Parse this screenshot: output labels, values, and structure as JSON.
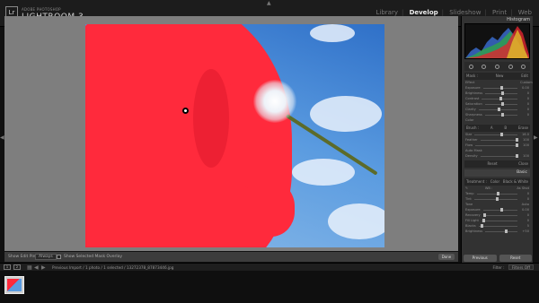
{
  "app": {
    "brand_small": "ADOBE PHOTOSHOP",
    "brand_name": "LIGHTROOM 3",
    "logo_text": "Lr"
  },
  "modules": [
    {
      "label": "Library",
      "active": false
    },
    {
      "label": "Develop",
      "active": true
    },
    {
      "label": "Slideshow",
      "active": false
    },
    {
      "label": "Print",
      "active": false
    },
    {
      "label": "Web",
      "active": false
    }
  ],
  "toolbar": {
    "overlay_label": "Show Edit Pins :",
    "overlay_value": "Always",
    "mask_label": "Show Selected Mask Overlay",
    "done_label": "Done"
  },
  "right_panel": {
    "histogram_title": "Histogram",
    "mask_header": {
      "mask": "Mask :",
      "new": "New",
      "edit": "Edit"
    },
    "adjust_rows": [
      {
        "label": "Effect",
        "value": "Custom"
      },
      {
        "label": "Exposure",
        "value": "0.00"
      },
      {
        "label": "Brightness",
        "value": "0"
      },
      {
        "label": "Contrast",
        "value": "0"
      },
      {
        "label": "Saturation",
        "value": "0"
      },
      {
        "label": "Clarity",
        "value": "0"
      },
      {
        "label": "Sharpness",
        "value": "0"
      },
      {
        "label": "Color",
        "value": ""
      }
    ],
    "brush_header": {
      "brush": "Brush :",
      "a": "A",
      "b": "B",
      "erase": "Erase"
    },
    "brush_rows": [
      {
        "label": "Size",
        "value": "16.0"
      },
      {
        "label": "Feather",
        "value": "100"
      },
      {
        "label": "Flow",
        "value": "100"
      },
      {
        "label": "Auto Mask",
        "value": ""
      },
      {
        "label": "Density",
        "value": "100"
      }
    ],
    "reset_label": "Reset",
    "close_label": "Close",
    "basic_title": "Basic",
    "treatment": {
      "label": "Treatment :",
      "color": "Color",
      "bw": "Black & White"
    },
    "wb": {
      "label": "WB :",
      "value": "As Shot"
    },
    "basic_rows": [
      {
        "label": "Temp",
        "value": "0"
      },
      {
        "label": "Tint",
        "value": "0"
      },
      {
        "label": "Tone",
        "value": "Auto"
      },
      {
        "label": "Exposure",
        "value": "0.00"
      },
      {
        "label": "Recovery",
        "value": "0"
      },
      {
        "label": "Fill Light",
        "value": "0"
      },
      {
        "label": "Blacks",
        "value": "5"
      },
      {
        "label": "Brightness",
        "value": "+50"
      }
    ],
    "previous_label": "Previous",
    "reset_btn_label": "Reset"
  },
  "filmstrip_bar": {
    "nav1": "1",
    "nav2": "2",
    "breadcrumb": "Previous Import / 1 photo / 1 selected / 13272378_87873446.jpg",
    "filter_label": "Filter :",
    "filter_value": "Filters Off"
  }
}
